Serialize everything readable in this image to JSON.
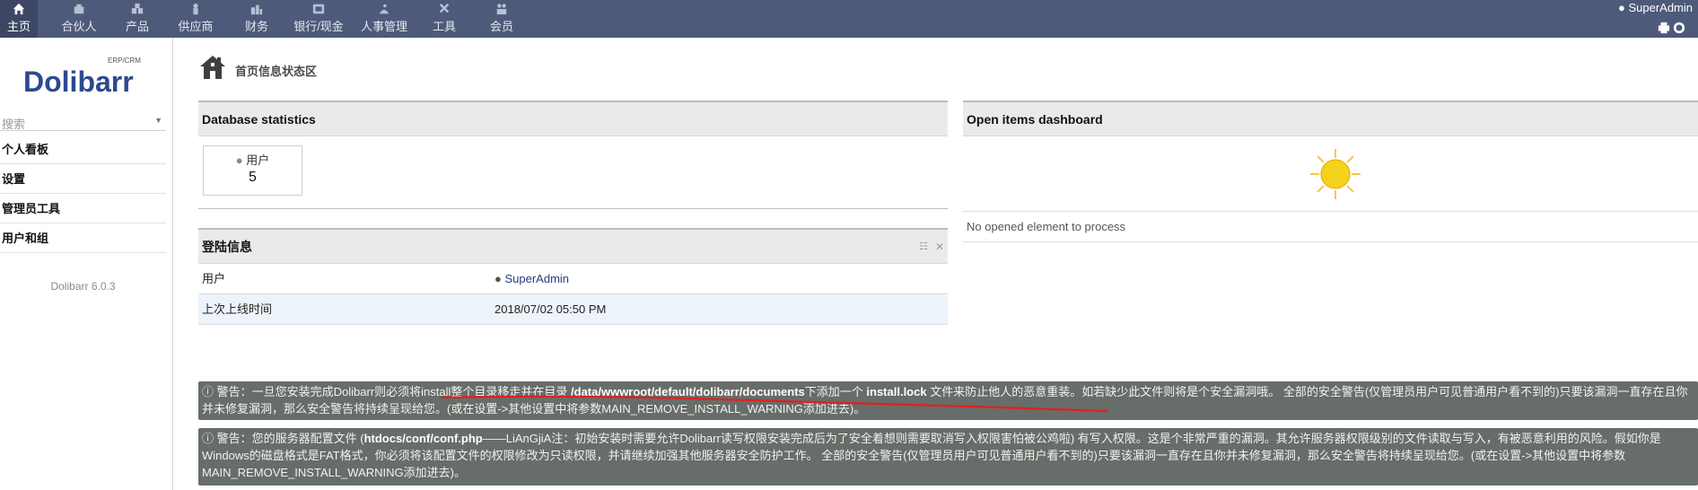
{
  "topnav": {
    "tabs": [
      {
        "label": "主页",
        "icon": "home-icon"
      },
      {
        "label": "合伙人",
        "icon": "partner-icon"
      },
      {
        "label": "产品",
        "icon": "product-icon"
      },
      {
        "label": "供应商",
        "icon": "supplier-icon"
      },
      {
        "label": "财务",
        "icon": "finance-icon"
      },
      {
        "label": "银行/现金",
        "icon": "bank-icon"
      },
      {
        "label": "人事管理",
        "icon": "hr-icon"
      },
      {
        "label": "工具",
        "icon": "tools-icon"
      },
      {
        "label": "会员",
        "icon": "member-icon"
      }
    ],
    "user": "SuperAdmin"
  },
  "sidebar": {
    "logo_text": "Dolibarr",
    "logo_sub": "ERP/CRM",
    "search_placeholder": "搜索",
    "items": [
      {
        "label": "个人看板"
      },
      {
        "label": "设置"
      },
      {
        "label": "管理员工具"
      },
      {
        "label": "用户和组"
      }
    ],
    "version": "Dolibarr 6.0.3"
  },
  "page": {
    "title": "首页信息状态区"
  },
  "db_stats": {
    "title": "Database statistics",
    "users_label": "用户",
    "users_count": "5"
  },
  "open_items": {
    "title": "Open items dashboard",
    "empty_text": "No opened element to process"
  },
  "login_info": {
    "title": "登陆信息",
    "rows": [
      {
        "key": "用户",
        "value": "SuperAdmin"
      },
      {
        "key": "上次上线时间",
        "value": "2018/07/02 05:50 PM"
      }
    ]
  },
  "warnings": {
    "w1_prefix": "警告：一旦您安装完成Dolibarr则必须将install整个目录移走并在目录 ",
    "w1_path": "/data/wwwroot/default/dolibarr/documents",
    "w1_mid": "下添加一个 ",
    "w1_file": "install.lock",
    "w1_suffix": " 文件来防止他人的恶意重装。如若缺少此文件则将是个安全漏洞哦。 全部的安全警告(仅管理员用户可见普通用户看不到的)只要该漏洞一直存在且你并未修复漏洞，那么安全警告将持续呈现给您。(或在设置->其他设置中将参数MAIN_REMOVE_INSTALL_WARNING添加进去)。",
    "w2_prefix": "警告：您的服务器配置文件 (",
    "w2_file": "htdocs/conf/conf.php",
    "w2_suffix": "——LiAnGjiA注：初始安装时需要允许Dolibarr读写权限安装完成后为了安全着想则需要取消写入权限害怕被公鸡啦) 有写入权限。这是个非常严重的漏洞。其允许服务器权限级别的文件读取与写入，有被恶意利用的风险。假如你是Windows的磁盘格式是FAT格式，你必须将该配置文件的权限修改为只读权限，并请继续加强其他服务器安全防护工作。 全部的安全警告(仅管理员用户可见普通用户看不到的)只要该漏洞一直存在且你并未修复漏洞，那么安全警告将持续呈现给您。(或在设置->其他设置中将参数MAIN_REMOVE_INSTALL_WARNING添加进去)。"
  }
}
